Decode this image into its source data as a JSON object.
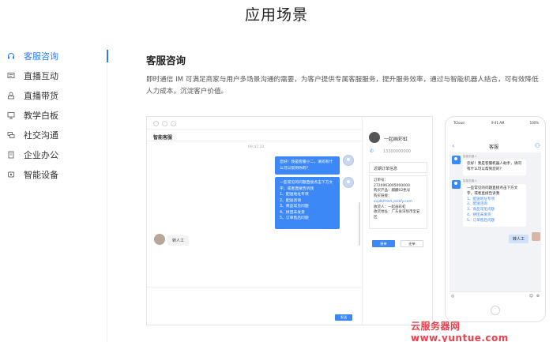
{
  "page": {
    "title": "应用场景"
  },
  "sidebar": {
    "items": [
      {
        "label": "客服咨询",
        "icon": "headset-icon",
        "active": true
      },
      {
        "label": "直播互动",
        "icon": "live-chat-icon",
        "active": false
      },
      {
        "label": "直播带货",
        "icon": "shopping-icon",
        "active": false
      },
      {
        "label": "教学白板",
        "icon": "whiteboard-icon",
        "active": false
      },
      {
        "label": "社交沟通",
        "icon": "social-icon",
        "active": false
      },
      {
        "label": "企业办公",
        "icon": "building-icon",
        "active": false
      },
      {
        "label": "智能设备",
        "icon": "device-icon",
        "active": false
      }
    ]
  },
  "content": {
    "title": "客服咨询",
    "description": "即时通信 IM 可满足商家与用户多场景沟通的需要，为客户提供专属客服服务，提升服务效率，通过与智能机器人结合，可有效降低人力成本，沉淀客户价值。"
  },
  "desktop": {
    "chat_title": "智能客服",
    "time": "09:47:23",
    "bot_greeting": "您好！我是客服小二，请问有什么可以帮到你的？",
    "bot_menu_intro": "一些常见的问题直接点击下方文字，或者直接告诉我",
    "bot_menu": [
      "1、配送地址专项",
      "2、配送咨询",
      "3、商品常见问题",
      "4、拼团未发货",
      "5、订单售后问题"
    ],
    "user_message": "转人工",
    "send_label": "发送",
    "customer": {
      "name": "一起画彩虹",
      "phone": "13300000000",
      "recent_orders_label": "近期订单信息",
      "order_lines": [
        "订单号：",
        "2720963005000000",
        "购买产品：麒麟02色号",
        "购买链接：",
        "xxjdklfdsd.jssikfy.com",
        "收货人：一起画彩虹",
        "收货地址：广东省深圳市宝安区"
      ],
      "confirm_label": "接单",
      "reject_label": "还单"
    }
  },
  "phone": {
    "status_carrier": "TCloud",
    "status_time": "9:41 AM",
    "status_battery": "100%",
    "nav_title": "客服",
    "bot_name": "智能机器人",
    "bot_greeting": "您好！我是客服机器人助手，请问有什么可以帮到您的？",
    "bot_menu_intro": "一些常见的问题直接点击下方文字，或者直接告诉我",
    "bot_menu": [
      "1、配送地址专项",
      "2、配送咨询",
      "3、商品常见问题",
      "4、拼团未发货",
      "5、订单售后问题"
    ],
    "user_message": "转人工"
  },
  "watermark": {
    "text": "云服务器网 www.yuntue.com"
  }
}
